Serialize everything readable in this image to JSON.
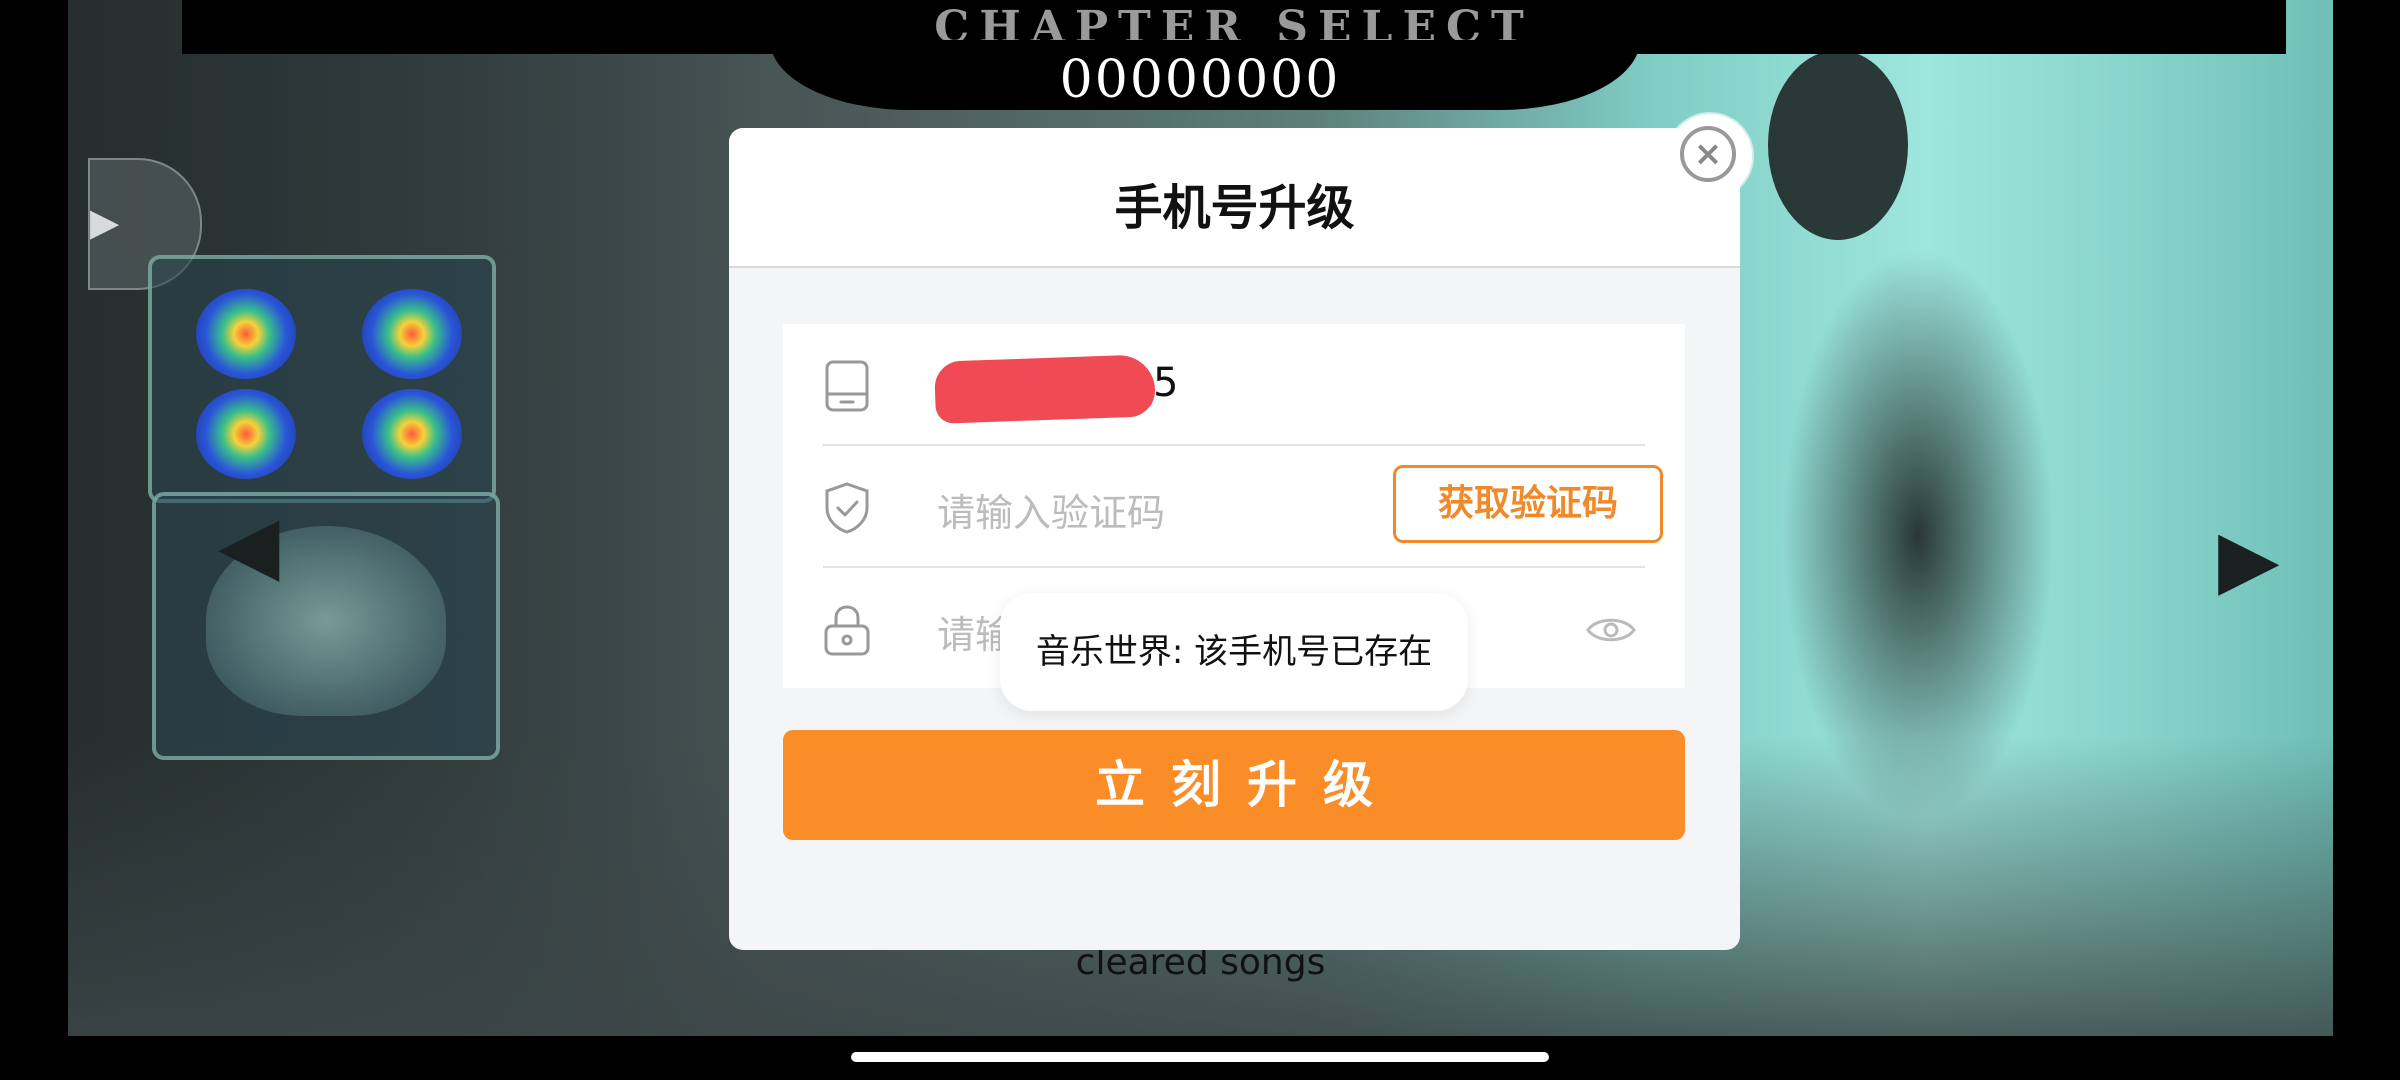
{
  "game": {
    "chapter_title": "CHAPTER SELECT",
    "score": "00000000",
    "cleared_label": "cleared songs",
    "play_icon": "play-icon",
    "nav_left_icon": "arrow-left-icon",
    "nav_right_icon": "arrow-right-icon"
  },
  "modal": {
    "title": "手机号升级",
    "close_icon": "close-icon",
    "phone": {
      "icon": "phone-icon",
      "value_visible_tail": "5",
      "redacted": true
    },
    "code": {
      "icon": "shield-check-icon",
      "placeholder": "请输入验证码",
      "button_label": "获取验证码"
    },
    "password": {
      "icon": "lock-icon",
      "placeholder_visible": "请输",
      "eye_icon": "eye-icon"
    },
    "submit_label": "立刻升级"
  },
  "toast": {
    "message": "音乐世界: 该手机号已存在"
  },
  "colors": {
    "accent": "#fb8d28",
    "accent_border": "#f0892a",
    "redaction": "#f04b55"
  }
}
